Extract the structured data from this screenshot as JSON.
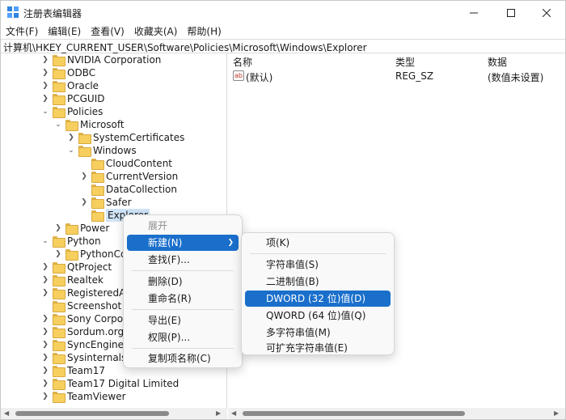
{
  "window": {
    "title": "注册表编辑器",
    "address": "计算机\\HKEY_CURRENT_USER\\Software\\Policies\\Microsoft\\Windows\\Explorer"
  },
  "menu": [
    "文件(F)",
    "编辑(E)",
    "查看(V)",
    "收藏夹(A)",
    "帮助(H)"
  ],
  "tree": [
    {
      "label": "NVIDIA Corporation",
      "expanded": false
    },
    {
      "label": "ODBC",
      "expanded": false
    },
    {
      "label": "Oracle",
      "expanded": false
    },
    {
      "label": "PCGUID",
      "expanded": false
    },
    {
      "label": "Policies",
      "expanded": true
    },
    {
      "label": "Microsoft",
      "expanded": true
    },
    {
      "label": "SystemCertificates",
      "expanded": false
    },
    {
      "label": "Windows",
      "expanded": true
    },
    {
      "label": "CloudContent",
      "expanded": false
    },
    {
      "label": "CurrentVersion",
      "expanded": false
    },
    {
      "label": "DataCollection",
      "expanded": false
    },
    {
      "label": "Safer",
      "expanded": false
    },
    {
      "label": "Explorer",
      "expanded": false
    },
    {
      "label": "Power",
      "expanded": false
    },
    {
      "label": "Python",
      "expanded": true
    },
    {
      "label": "PythonCore",
      "expanded": false
    },
    {
      "label": "QtProject",
      "expanded": false
    },
    {
      "label": "Realtek",
      "expanded": false
    },
    {
      "label": "RegisteredApplications",
      "expanded": false
    },
    {
      "label": "Screenshot Studio",
      "expanded": false
    },
    {
      "label": "Sony Corporation",
      "expanded": false
    },
    {
      "label": "Sordum.org",
      "expanded": false
    },
    {
      "label": "SyncEngines",
      "expanded": false
    },
    {
      "label": "Sysinternals",
      "expanded": false
    },
    {
      "label": "Team17",
      "expanded": false
    },
    {
      "label": "Team17 Digital Limited",
      "expanded": false
    },
    {
      "label": "TeamViewer",
      "expanded": false
    }
  ],
  "list": {
    "headers": {
      "name": "名称",
      "type": "类型",
      "data": "数据"
    },
    "rows": [
      {
        "icon": "ab",
        "name": "(默认)",
        "type": "REG_SZ",
        "data": "(数值未设置)"
      }
    ]
  },
  "context_menu": {
    "items": [
      {
        "label": "展开",
        "disabled": true
      },
      {
        "label": "新建(N)",
        "highlighted": true,
        "submenu": true
      },
      {
        "label": "查找(F)..."
      },
      {
        "label": "删除(D)"
      },
      {
        "label": "重命名(R)"
      },
      {
        "label": "导出(E)"
      },
      {
        "label": "权限(P)..."
      },
      {
        "label": "复制项名称(C)"
      }
    ]
  },
  "submenu": {
    "items": [
      {
        "label": "项(K)"
      },
      {
        "label": "字符串值(S)"
      },
      {
        "label": "二进制值(B)"
      },
      {
        "label": "DWORD (32 位)值(D)",
        "highlighted": true
      },
      {
        "label": "QWORD (64 位)值(Q)"
      },
      {
        "label": "多字符串值(M)"
      },
      {
        "label": "可扩充字符串值(E)"
      }
    ]
  },
  "colors": {
    "highlight": "#1a6fcb",
    "selection": "#cfe3f7",
    "folder": "#f6cf5f"
  }
}
